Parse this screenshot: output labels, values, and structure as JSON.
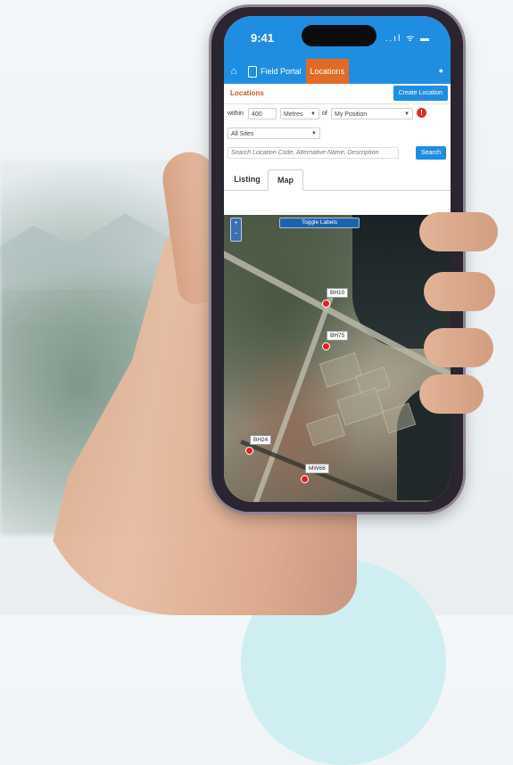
{
  "status_bar": {
    "time": "9:41",
    "signal": "..ıl ᯤ ▬"
  },
  "navbar": {
    "home_icon": "home-icon",
    "items": [
      {
        "label": "Field Portal",
        "active": false
      },
      {
        "label": "Locations",
        "active": true
      }
    ],
    "user_icon": "user-icon"
  },
  "locations": {
    "title": "Locations",
    "create_label": "Create Location"
  },
  "filter": {
    "within_label": "within",
    "distance_value": "400",
    "unit_value": "Metres",
    "of_label": "of",
    "position_value": "My Position",
    "sites_value": "All Sites",
    "search_placeholder": "Search Location Code, Alternative Name, Description",
    "search_label": "Search"
  },
  "tabs": [
    {
      "label": "Listing",
      "active": false
    },
    {
      "label": "Map",
      "active": true
    }
  ],
  "map": {
    "toggle_label": "Toggle Labels",
    "zoom_in": "+",
    "zoom_out": "−",
    "markers": [
      "BH10",
      "BH75",
      "BH24",
      "MW68"
    ]
  },
  "colors": {
    "primary": "#1f8ee0",
    "active_tab": "#e26a26",
    "heading": "#d2561b",
    "marker": "#e02020"
  }
}
